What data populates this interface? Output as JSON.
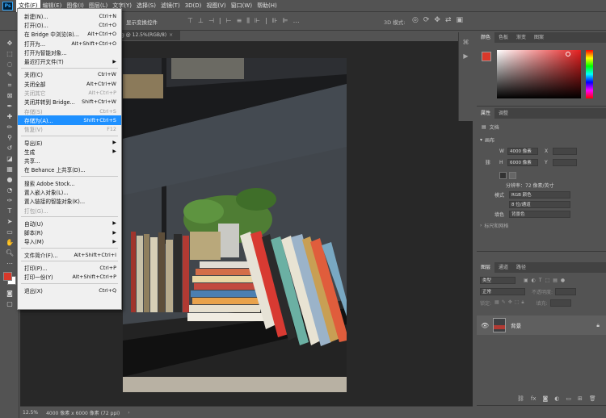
{
  "menubar": {
    "items": [
      "文件(F)",
      "编辑(E)",
      "图像(I)",
      "图层(L)",
      "文字(Y)",
      "选择(S)",
      "滤镜(T)",
      "3D(D)",
      "视图(V)",
      "窗口(W)",
      "帮助(H)"
    ]
  },
  "options": {
    "auto_select": "显示变换控件",
    "mode3d": "3D 模式:"
  },
  "doc_tab": "g @ 12.5%(RGB/8)",
  "status": {
    "zoom": "12.5%",
    "info": "4000 像素 x 6000 像素 (72 ppi)"
  },
  "file_menu": {
    "items": [
      {
        "label": "新建(N)...",
        "shortcut": "Ctrl+N",
        "disabled": false,
        "sub": false
      },
      {
        "label": "打开(O)...",
        "shortcut": "Ctrl+O",
        "disabled": false,
        "sub": false
      },
      {
        "label": "在 Bridge 中浏览(B)...",
        "shortcut": "Alt+Ctrl+O",
        "disabled": false,
        "sub": false
      },
      {
        "label": "打开为...",
        "shortcut": "Alt+Shift+Ctrl+O",
        "disabled": false,
        "sub": false
      },
      {
        "label": "打开为智能对象...",
        "shortcut": "",
        "disabled": false,
        "sub": false
      },
      {
        "label": "最近打开文件(T)",
        "shortcut": "",
        "disabled": false,
        "sub": true
      },
      {
        "sep": true
      },
      {
        "label": "关闭(C)",
        "shortcut": "Ctrl+W",
        "disabled": false,
        "sub": false
      },
      {
        "label": "关闭全部",
        "shortcut": "Alt+Ctrl+W",
        "disabled": false,
        "sub": false
      },
      {
        "label": "关闭其它",
        "shortcut": "Alt+Ctrl+P",
        "disabled": true,
        "sub": false
      },
      {
        "label": "关闭并转到 Bridge...",
        "shortcut": "Shift+Ctrl+W",
        "disabled": false,
        "sub": false
      },
      {
        "label": "存储(S)",
        "shortcut": "Ctrl+S",
        "disabled": true,
        "sub": false
      },
      {
        "label": "存储为(A)...",
        "shortcut": "Shift+Ctrl+S",
        "disabled": false,
        "sub": false,
        "highlight": true
      },
      {
        "label": "恢复(V)",
        "shortcut": "F12",
        "disabled": true,
        "sub": false
      },
      {
        "sep": true
      },
      {
        "label": "导出(E)",
        "shortcut": "",
        "disabled": false,
        "sub": true
      },
      {
        "label": "生成",
        "shortcut": "",
        "disabled": false,
        "sub": true
      },
      {
        "label": "共享...",
        "shortcut": "",
        "disabled": false,
        "sub": false
      },
      {
        "label": "在 Behance 上共享(D)...",
        "shortcut": "",
        "disabled": false,
        "sub": false
      },
      {
        "sep": true
      },
      {
        "label": "搜索 Adobe Stock...",
        "shortcut": "",
        "disabled": false,
        "sub": false
      },
      {
        "label": "置入嵌入对象(L)...",
        "shortcut": "",
        "disabled": false,
        "sub": false
      },
      {
        "label": "置入链接的智能对象(K)...",
        "shortcut": "",
        "disabled": false,
        "sub": false
      },
      {
        "label": "打包(G)...",
        "shortcut": "",
        "disabled": true,
        "sub": false
      },
      {
        "sep": true
      },
      {
        "label": "自动(U)",
        "shortcut": "",
        "disabled": false,
        "sub": true
      },
      {
        "label": "脚本(R)",
        "shortcut": "",
        "disabled": false,
        "sub": true
      },
      {
        "label": "导入(M)",
        "shortcut": "",
        "disabled": false,
        "sub": true
      },
      {
        "sep": true
      },
      {
        "label": "文件简介(F)...",
        "shortcut": "Alt+Shift+Ctrl+I",
        "disabled": false,
        "sub": false
      },
      {
        "sep": true
      },
      {
        "label": "打印(P)...",
        "shortcut": "Ctrl+P",
        "disabled": false,
        "sub": false
      },
      {
        "label": "打印一份(Y)",
        "shortcut": "Alt+Shift+Ctrl+P",
        "disabled": false,
        "sub": false
      },
      {
        "sep": true
      },
      {
        "label": "退出(X)",
        "shortcut": "Ctrl+Q",
        "disabled": false,
        "sub": false
      }
    ]
  },
  "color_panel": {
    "tabs": [
      "颜色",
      "色板",
      "渐变",
      "图案"
    ],
    "fg": "#d9382a"
  },
  "props_panel": {
    "tabs": [
      "属性",
      "调整"
    ],
    "doc_label": "文档",
    "canvas": "画布",
    "w_label": "W",
    "h_label": "H",
    "w": "4000 像素",
    "h": "6000 像素",
    "x_label": "X",
    "y_label": "Y",
    "resolution": "分辨率：72 像素/英寸",
    "mode_label": "模式",
    "mode": "RGB 颜色",
    "depth": "8 位/通道",
    "fill_label": "填色",
    "fill": "背景色",
    "guides": "标尺和网格"
  },
  "layers_panel": {
    "tabs": [
      "图层",
      "通道",
      "路径"
    ],
    "kind": "类型",
    "blend": "正常",
    "opacity": "不透明度:",
    "lock": "锁定:",
    "fill": "填充:",
    "layer_name": "背景"
  }
}
